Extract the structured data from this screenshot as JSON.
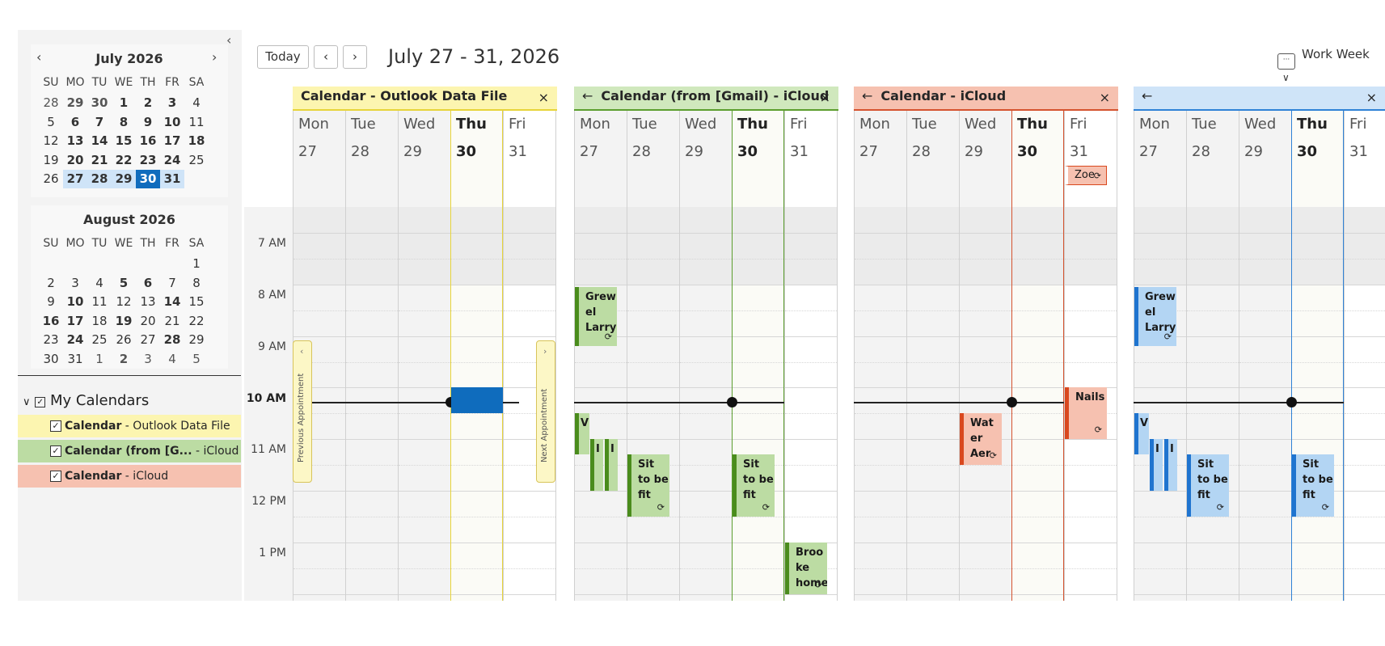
{
  "toolbar": {
    "today_label": "Today",
    "prev_icon": "chevron-left",
    "next_icon": "chevron-right",
    "date_range": "July 27 - 31, 2026",
    "view_label": "Work Week",
    "view_icon": "calendar-icon"
  },
  "collapse_icon": "‹",
  "mini_calendars": [
    {
      "title": "July 2026",
      "weekday_headers": [
        "SU",
        "MO",
        "TU",
        "WE",
        "TH",
        "FR",
        "SA"
      ],
      "rows": [
        [
          "28",
          "29",
          "30",
          "1",
          "2",
          "3",
          "4"
        ],
        [
          "5",
          "6",
          "7",
          "8",
          "9",
          "10",
          "11"
        ],
        [
          "12",
          "13",
          "14",
          "15",
          "16",
          "17",
          "18"
        ],
        [
          "19",
          "20",
          "21",
          "22",
          "23",
          "24",
          "25"
        ],
        [
          "26",
          "27",
          "28",
          "29",
          "30",
          "31",
          ""
        ]
      ],
      "bold_days": [
        "1",
        "2",
        "3",
        "6",
        "7",
        "8",
        "9",
        "10",
        "13",
        "14",
        "15",
        "16",
        "17",
        "18",
        "20",
        "21",
        "22",
        "23",
        "24",
        "27",
        "28",
        "29",
        "30",
        "31"
      ],
      "prev_month_days": [
        "28",
        "29",
        "30"
      ],
      "selected_week": [
        "27",
        "28",
        "29",
        "30",
        "31"
      ],
      "today": "30"
    },
    {
      "title": "August 2026",
      "weekday_headers": [
        "SU",
        "MO",
        "TU",
        "WE",
        "TH",
        "FR",
        "SA"
      ],
      "rows": [
        [
          "",
          "",
          "",
          "",
          "",
          "",
          "1"
        ],
        [
          "2",
          "3",
          "4",
          "5",
          "6",
          "7",
          "8"
        ],
        [
          "9",
          "10",
          "11",
          "12",
          "13",
          "14",
          "15"
        ],
        [
          "16",
          "17",
          "18",
          "19",
          "20",
          "21",
          "22"
        ],
        [
          "23",
          "24",
          "25",
          "26",
          "27",
          "28",
          "29"
        ],
        [
          "30",
          "31",
          "1",
          "2",
          "3",
          "4",
          "5"
        ]
      ],
      "bold_days": [
        "5",
        "6",
        "10",
        "14",
        "16",
        "17",
        "19",
        "24",
        "28"
      ],
      "bold_next": [
        "2"
      ]
    }
  ],
  "my_calendars": {
    "label": "My Calendars",
    "items": [
      {
        "name": "Calendar",
        "suffix": " - Outlook Data File",
        "color": "#fcf5b0",
        "checked": true
      },
      {
        "name": "Calendar (from [G...",
        "suffix": " - iCloud",
        "color": "#bcdca3",
        "checked": true
      },
      {
        "name": "Calendar",
        "suffix": " - iCloud",
        "color": "#f6c1b0",
        "checked": true
      }
    ]
  },
  "time_labels": [
    "7 AM",
    "8 AM",
    "9 AM",
    "10 AM",
    "11 AM",
    "12 PM",
    "1 PM"
  ],
  "days": [
    {
      "name": "Mon",
      "num": "27"
    },
    {
      "name": "Tue",
      "num": "28"
    },
    {
      "name": "Wed",
      "num": "29"
    },
    {
      "name": "Thu",
      "num": "30"
    },
    {
      "name": "Fri",
      "num": "31"
    }
  ],
  "calendars": [
    {
      "title": "Calendar - Outlook Data File",
      "back": false,
      "header_color": "#fcf5b0",
      "accent": "#e7d43a",
      "prev_appointment": "Previous Appointment",
      "next_appointment": "Next Appointment"
    },
    {
      "title": "Calendar (from [Gmail) - iCloud",
      "back": true,
      "header_color": "#d0e8bd",
      "accent": "#5c9e2e",
      "event_fill": "#bcdca3",
      "event_bar": "#4a8c1c",
      "events": [
        {
          "title": "Grewel Larry",
          "text": "Grew el Larry"
        },
        {
          "title": "V...",
          "text": "V"
        },
        {
          "title": "I...",
          "text": "I"
        },
        {
          "title": "I...",
          "text": "I"
        },
        {
          "title": "Sit to be fit (Tue)",
          "text": "Sit to be fit"
        },
        {
          "title": "Sit to be fit (Thu)",
          "text": "Sit to be fit"
        },
        {
          "title": "Brooke home",
          "text": "Broo ke home"
        }
      ]
    },
    {
      "title": "Calendar - iCloud",
      "back": true,
      "header_color": "#f6c1b0",
      "accent": "#d5532f",
      "event_fill": "#f6c1b0",
      "event_bar": "#d9481e",
      "events": [
        {
          "title": "Zoe",
          "text": "Zoe"
        },
        {
          "title": "Water Aerobics",
          "text": "Wat er Aer"
        },
        {
          "title": "Nails",
          "text": "Nails"
        }
      ]
    },
    {
      "title": "",
      "back": true,
      "header_color": "#cfe4f8",
      "accent": "#2f82d6",
      "event_fill": "#b3d5f3",
      "event_bar": "#1f74cf",
      "events": [
        {
          "title": "Grewel Larry",
          "text": "Grew el Larry"
        },
        {
          "title": "V...",
          "text": "V"
        },
        {
          "title": "I...",
          "text": "I"
        },
        {
          "title": "I...",
          "text": "I"
        },
        {
          "title": "Sit to be fit (Tue)",
          "text": "Sit to be fit"
        },
        {
          "title": "Sit to be fit (Thu)",
          "text": "Sit to be fit"
        }
      ]
    }
  ]
}
